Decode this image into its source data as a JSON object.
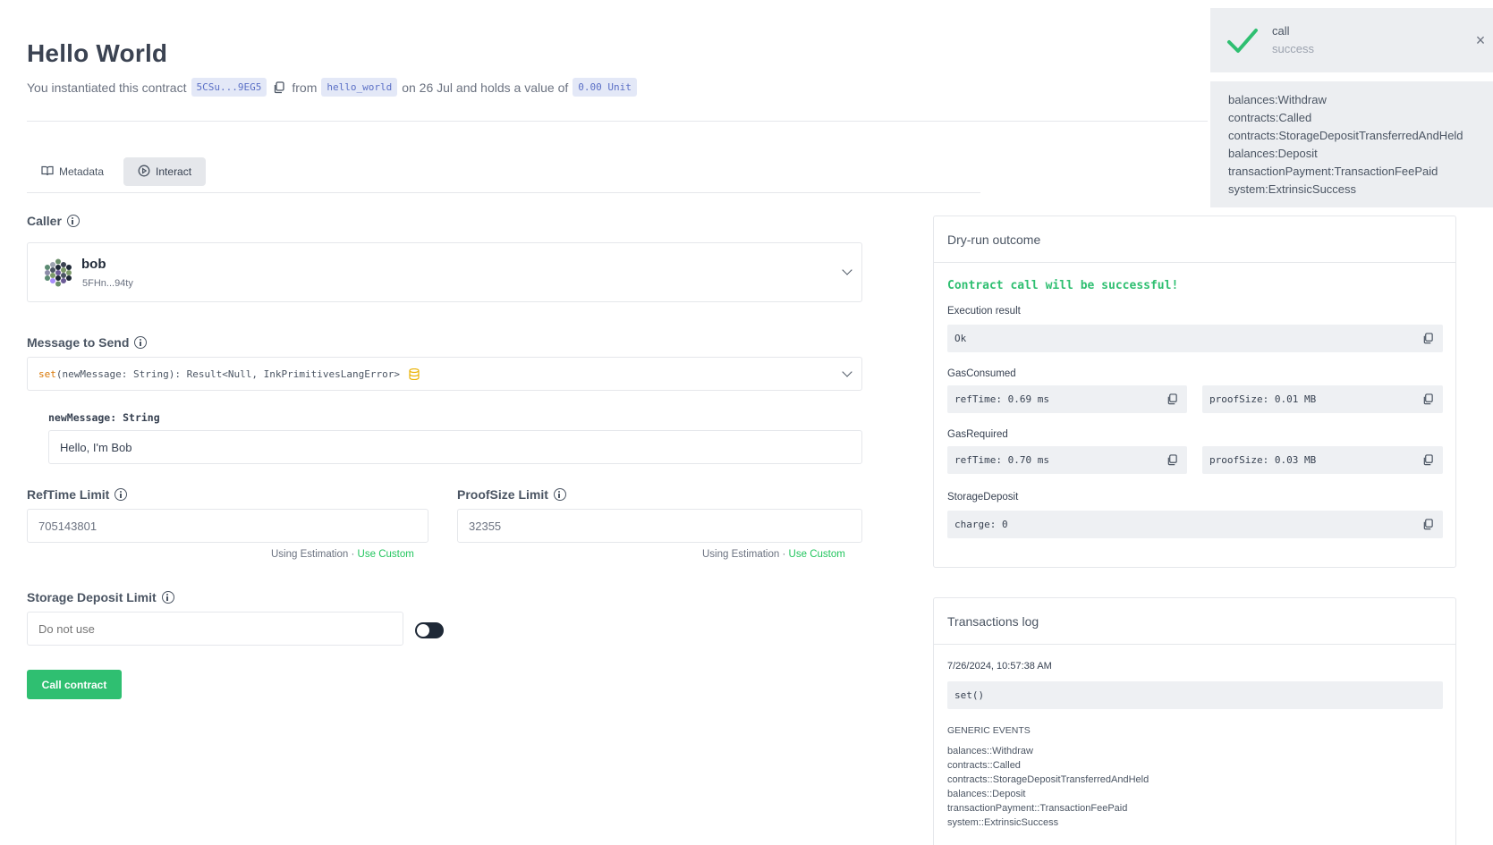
{
  "header": {
    "title": "Hello World",
    "sub_prefix": "You instantiated this contract",
    "contract_addr": "5CSu...9EG5",
    "from_word": "from",
    "code_name": "hello_world",
    "date_phrase": "on 26 Jul and holds a value of",
    "value": "0.00 Unit"
  },
  "tabs": [
    {
      "label": "Metadata",
      "icon": "book-icon"
    },
    {
      "label": "Interact",
      "icon": "play-circle-icon"
    }
  ],
  "form": {
    "caller_label": "Caller",
    "caller_name": "bob",
    "caller_addr": "5FHn...94ty",
    "message_label": "Message to Send",
    "message_fn": "set",
    "message_sig": "(newMessage: String): Result<Null, InkPrimitivesLangError>",
    "param_name": "newMessage:",
    "param_type": "String",
    "param_value": "Hello, I'm Bob",
    "reftime_label": "RefTime Limit",
    "reftime_value": "705143801",
    "proofsize_label": "ProofSize Limit",
    "proofsize_value": "32355",
    "using_estimation": "Using Estimation",
    "dot": "·",
    "use_custom": "Use Custom",
    "storage_label": "Storage Deposit Limit",
    "storage_placeholder": "Do not use",
    "call_button": "Call contract"
  },
  "dry_run": {
    "title": "Dry-run outcome",
    "success": "Contract call will be successful!",
    "execution_label": "Execution result",
    "execution_value": "Ok",
    "gas_consumed_label": "GasConsumed",
    "gas_consumed_ref": "refTime: 0.69 ms",
    "gas_consumed_proof": "proofSize: 0.01 MB",
    "gas_required_label": "GasRequired",
    "gas_required_ref": "refTime: 0.70 ms",
    "gas_required_proof": "proofSize: 0.03 MB",
    "storage_label": "StorageDeposit",
    "storage_value": "charge: 0"
  },
  "tx_log": {
    "title": "Transactions log",
    "time": "7/26/2024, 10:57:38 AM",
    "call": "set()",
    "generic_title": "GENERIC EVENTS",
    "events": [
      "balances::Withdraw",
      "contracts::Called",
      "contracts::StorageDepositTransferredAndHeld",
      "balances::Deposit",
      "transactionPayment::TransactionFeePaid",
      "system::ExtrinsicSuccess"
    ]
  },
  "toast": {
    "title": "call",
    "status": "success",
    "events": [
      "balances:Withdraw",
      "contracts:Called",
      "contracts:StorageDepositTransferredAndHeld",
      "balances:Deposit",
      "transactionPayment:TransactionFeePaid",
      "system:ExtrinsicSuccess"
    ]
  },
  "colors": {
    "accent": "#2fbf71",
    "chip_bg": "#e3e8f7",
    "chip_text": "#5b70c6"
  }
}
